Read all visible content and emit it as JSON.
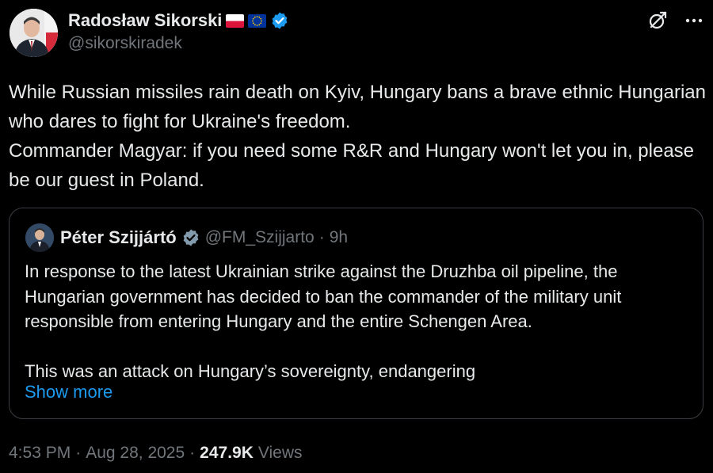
{
  "author": {
    "display_name": "Radosław Sikorski",
    "handle": "@sikorskiradek",
    "flags": [
      "poland-flag",
      "eu-flag"
    ],
    "verified": true
  },
  "tweet": {
    "text": "While Russian missiles rain death on Kyiv, Hungary bans a brave ethnic Hungarian who dares to fight for Ukraine's freedom.\nCommander Magyar: if you need some R&R and Hungary won't let you in, please be our guest in Poland."
  },
  "quote": {
    "display_name": "Péter Szijjártó",
    "handle": "@FM_Szijjarto",
    "separator": "·",
    "time": "9h",
    "text": "In response to the latest Ukrainian strike against the Druzhba oil pipeline, the Hungarian government has decided to ban the commander of the military unit responsible from entering Hungary and the entire Schengen Area.\n\nThis was an attack on Hungary’s sovereignty, endangering",
    "show_more": "Show more"
  },
  "meta": {
    "time": "4:53 PM",
    "sep1": "·",
    "date": "Aug 28, 2025",
    "sep2": "·",
    "views_count": "247.9K",
    "views_label": "Views"
  },
  "colors": {
    "background": "#000000",
    "text": "#e7e9ea",
    "muted": "#71767b",
    "link": "#1d9bf0",
    "verified": "#1d9bf0",
    "border": "#3a3d42"
  },
  "icons": {
    "grok": "grok-icon",
    "more": "more-icon",
    "verified": "verified-badge-icon"
  }
}
